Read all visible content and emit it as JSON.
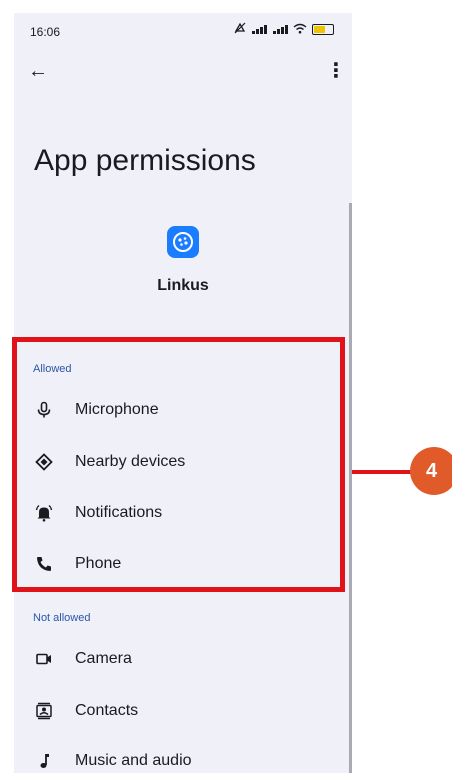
{
  "status_bar": {
    "time": "16:06",
    "battery_level": "65"
  },
  "page": {
    "title": "App permissions"
  },
  "app": {
    "name": "Linkus",
    "icon_color": "#1a7cff"
  },
  "sections": {
    "allowed": {
      "label": "Allowed",
      "items": [
        {
          "label": "Microphone",
          "icon": "microphone-icon"
        },
        {
          "label": "Nearby devices",
          "icon": "nearby-devices-icon"
        },
        {
          "label": "Notifications",
          "icon": "bell-icon"
        },
        {
          "label": "Phone",
          "icon": "phone-icon"
        }
      ]
    },
    "not_allowed": {
      "label": "Not allowed",
      "items": [
        {
          "label": "Camera",
          "icon": "camera-icon"
        },
        {
          "label": "Contacts",
          "icon": "contacts-icon"
        },
        {
          "label": "Music and audio",
          "icon": "music-note-icon"
        }
      ]
    }
  },
  "annotation": {
    "callout_number": "4",
    "highlight_color": "#e0131a",
    "callout_color": "#e05a2a"
  }
}
